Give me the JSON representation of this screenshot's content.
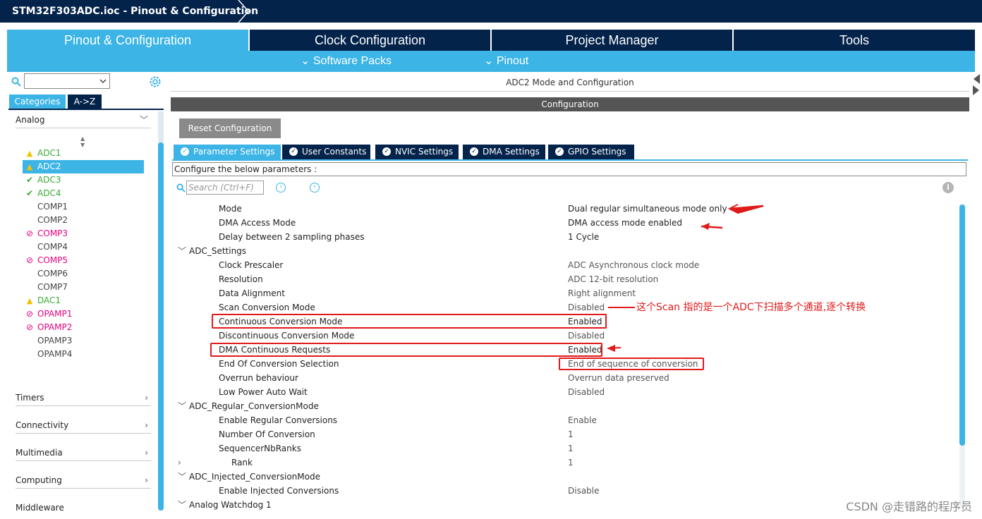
{
  "breadcrumb": {
    "title": "STM32F303ADC.ioc - Pinout & Configuration"
  },
  "main_tabs": [
    {
      "label": "Pinout & Configuration",
      "active": true
    },
    {
      "label": "Clock Configuration",
      "active": false
    },
    {
      "label": "Project Manager",
      "active": false
    },
    {
      "label": "Tools",
      "active": false
    }
  ],
  "sub_menu": {
    "software_packs": "Software Packs",
    "pinout": "Pinout"
  },
  "left_panel": {
    "category_tabs": [
      "Categories",
      "A->Z"
    ],
    "active_group": "Analog",
    "peripherals": [
      {
        "label": "ADC1",
        "status": "warning",
        "selected": false
      },
      {
        "label": "ADC2",
        "status": "warning",
        "selected": true
      },
      {
        "label": "ADC3",
        "status": "ok",
        "selected": false
      },
      {
        "label": "ADC4",
        "status": "ok",
        "selected": false
      },
      {
        "label": "COMP1",
        "status": "none",
        "selected": false
      },
      {
        "label": "COMP2",
        "status": "none",
        "selected": false
      },
      {
        "label": "COMP3",
        "status": "disabled",
        "selected": false
      },
      {
        "label": "COMP4",
        "status": "none",
        "selected": false
      },
      {
        "label": "COMP5",
        "status": "disabled",
        "selected": false
      },
      {
        "label": "COMP6",
        "status": "none",
        "selected": false
      },
      {
        "label": "COMP7",
        "status": "none",
        "selected": false
      },
      {
        "label": "DAC1",
        "status": "warning",
        "selected": false
      },
      {
        "label": "OPAMP1",
        "status": "disabled",
        "selected": false
      },
      {
        "label": "OPAMP2",
        "status": "disabled",
        "selected": false
      },
      {
        "label": "OPAMP3",
        "status": "none",
        "selected": false
      },
      {
        "label": "OPAMP4",
        "status": "none",
        "selected": false
      }
    ],
    "groups": [
      "Timers",
      "Connectivity",
      "Multimedia",
      "Computing",
      "Middleware"
    ]
  },
  "right_panel": {
    "mode_title": "ADC2 Mode and Configuration",
    "config_title": "Configuration",
    "reset_label": "Reset Configuration",
    "param_tabs": [
      "Parameter Settings",
      "User Constants",
      "NVIC Settings",
      "DMA Settings",
      "GPIO Settings"
    ],
    "configure_text": "Configure the below parameters :",
    "search_placeholder": "Search (Ctrl+F)",
    "params": [
      {
        "name": "Mode",
        "value": "Dual regular simultaneous mode only",
        "level": 2
      },
      {
        "name": "DMA Access Mode",
        "value": "DMA access mode enabled",
        "level": 2
      },
      {
        "name": "Delay between 2 sampling phases",
        "value": "1 Cycle",
        "level": 2
      },
      {
        "name": "ADC_Settings",
        "value": "",
        "level": 1,
        "toggle": "open"
      },
      {
        "name": "Clock Prescaler",
        "value": "ADC Asynchronous clock mode",
        "level": 2
      },
      {
        "name": "Resolution",
        "value": "ADC 12-bit resolution",
        "level": 2
      },
      {
        "name": "Data Alignment",
        "value": "Right alignment",
        "level": 2
      },
      {
        "name": "Scan Conversion Mode",
        "value": "Disabled",
        "level": 2
      },
      {
        "name": "Continuous Conversion Mode",
        "value": "Enabled",
        "level": 2
      },
      {
        "name": "Discontinuous Conversion Mode",
        "value": "Disabled",
        "level": 2
      },
      {
        "name": "DMA Continuous Requests",
        "value": "Enabled",
        "level": 2
      },
      {
        "name": "End Of Conversion Selection",
        "value": "End of sequence of conversion",
        "level": 2
      },
      {
        "name": "Overrun behaviour",
        "value": "Overrun data preserved",
        "level": 2
      },
      {
        "name": "Low Power Auto Wait",
        "value": "Disabled",
        "level": 2
      },
      {
        "name": "ADC_Regular_ConversionMode",
        "value": "",
        "level": 1,
        "toggle": "open"
      },
      {
        "name": "Enable Regular Conversions",
        "value": "Enable",
        "level": 2
      },
      {
        "name": "Number Of Conversion",
        "value": "1",
        "level": 2
      },
      {
        "name": "SequencerNbRanks",
        "value": "1",
        "level": 2
      },
      {
        "name": "Rank",
        "value": "1",
        "level": 3,
        "toggle": "closed"
      },
      {
        "name": "ADC_Injected_ConversionMode",
        "value": "",
        "level": 1,
        "toggle": "open"
      },
      {
        "name": "Enable Injected Conversions",
        "value": "Disable",
        "level": 2
      },
      {
        "name": "Analog Watchdog 1",
        "value": "",
        "level": 1,
        "toggle": "open"
      }
    ]
  },
  "annotation": "这个Scan 指的是一个ADC下扫描多个通道,逐个转换",
  "watermark": "CSDN @走错路的程序员",
  "colors": {
    "navy": "#03234b",
    "accent": "#3cb4e6",
    "warning": "#f2c200",
    "ok": "#3aaa35",
    "disabled": "#e6007e",
    "annotation": "#e01a1a"
  }
}
